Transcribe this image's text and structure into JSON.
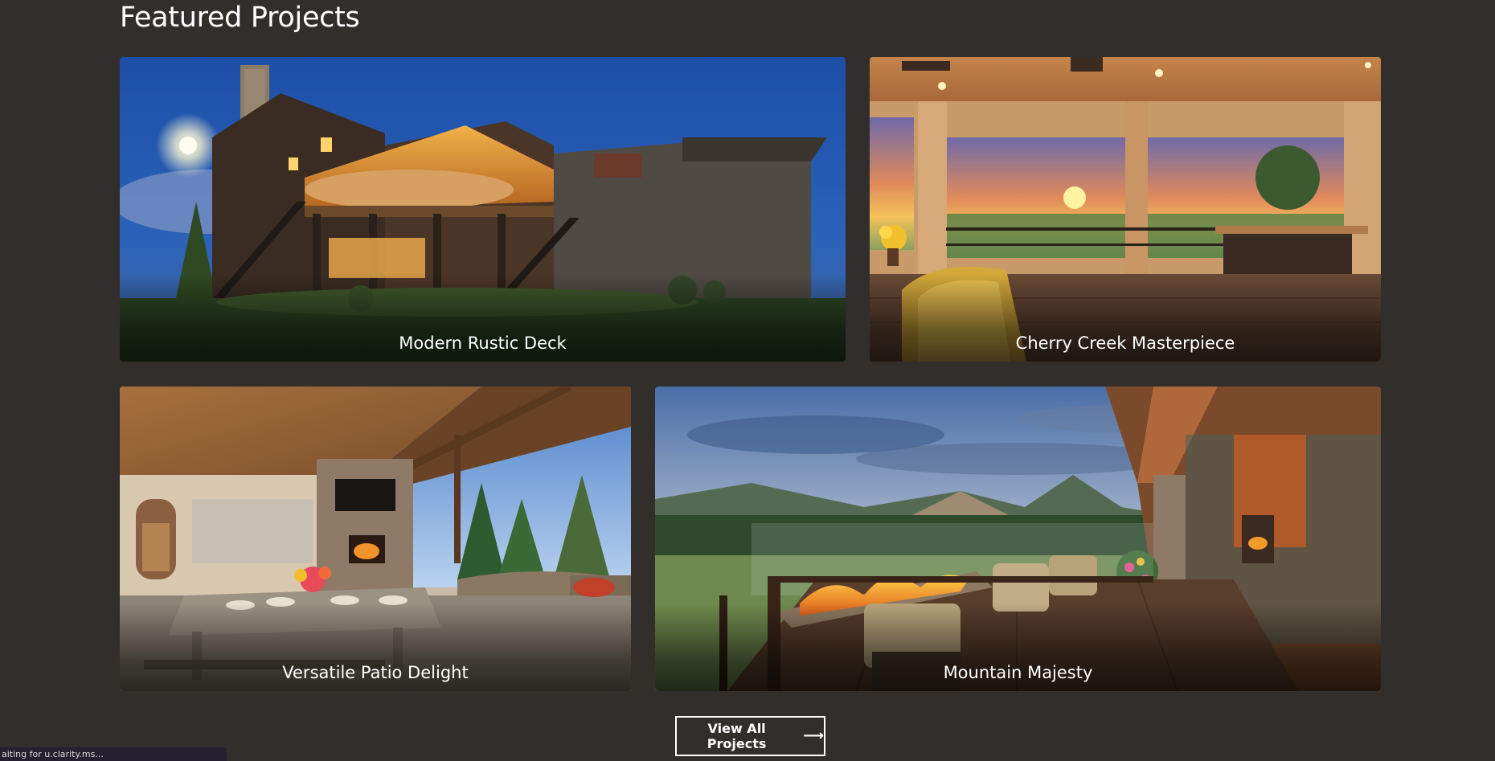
{
  "section": {
    "title": "Featured Projects"
  },
  "projects": [
    {
      "title": "Modern Rustic Deck",
      "photo_icon": "house-deck-night-photo"
    },
    {
      "title": "Cherry Creek Masterpiece",
      "photo_icon": "covered-patio-sunset-photo"
    },
    {
      "title": "Versatile Patio Delight",
      "photo_icon": "patio-fireplace-photo"
    },
    {
      "title": "Mountain Majesty",
      "photo_icon": "mountain-deck-firepit-photo"
    }
  ],
  "cta": {
    "label": "View All Projects",
    "arrow_icon": "arrow-right-icon"
  },
  "status": {
    "text": "aiting for u.clarity.ms..."
  },
  "colors": {
    "background": "#322e2c",
    "text": "#ffffff"
  }
}
